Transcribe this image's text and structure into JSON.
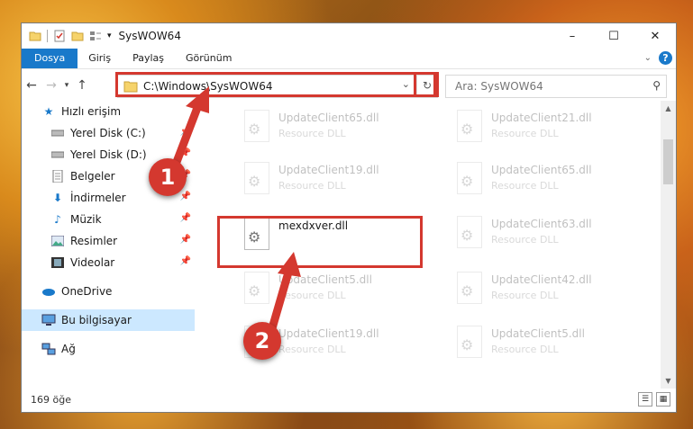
{
  "window": {
    "title": "SysWOW64",
    "controls": {
      "minimize": "–",
      "maximize": "☐",
      "close": "✕"
    }
  },
  "ribbon": {
    "tabs": [
      {
        "label": "Dosya",
        "active": true
      },
      {
        "label": "Giriş",
        "active": false
      },
      {
        "label": "Paylaş",
        "active": false
      },
      {
        "label": "Görünüm",
        "active": false
      }
    ],
    "help_label": "?"
  },
  "address": {
    "path": "C:\\Windows\\SysWOW64",
    "search_placeholder": "Ara: SysWOW64"
  },
  "nav": {
    "items": [
      {
        "label": "Hızlı erişim",
        "icon": "star-icon",
        "pinned": false
      },
      {
        "label": "Yerel Disk (C:)",
        "icon": "drive-icon",
        "pinned": true
      },
      {
        "label": "Yerel Disk (D:)",
        "icon": "drive-icon",
        "pinned": true
      },
      {
        "label": "Belgeler",
        "icon": "document-icon",
        "pinned": true
      },
      {
        "label": "İndirmeler",
        "icon": "download-icon",
        "pinned": true
      },
      {
        "label": "Müzik",
        "icon": "music-icon",
        "pinned": true
      },
      {
        "label": "Resimler",
        "icon": "picture-icon",
        "pinned": true
      },
      {
        "label": "Videolar",
        "icon": "video-icon",
        "pinned": true
      },
      {
        "label": "OneDrive",
        "icon": "cloud-icon",
        "pinned": false
      },
      {
        "label": "Bu bilgisayar",
        "icon": "computer-icon",
        "pinned": false,
        "selected": true
      },
      {
        "label": "Ağ",
        "icon": "network-icon",
        "pinned": false
      }
    ]
  },
  "files": [
    {
      "name": "UpdateClient65.dll",
      "type": "Resource DLL",
      "faded": true
    },
    {
      "name": "UpdateClient21.dll",
      "type": "Resource DLL",
      "faded": true
    },
    {
      "name": "UpdateClient19.dll",
      "type": "Resource DLL",
      "faded": true
    },
    {
      "name": "UpdateClient65.dll",
      "type": "Resource DLL",
      "faded": true
    },
    {
      "name": "mexdxver.dll",
      "type": "",
      "faded": false
    },
    {
      "name": "UpdateClient63.dll",
      "type": "Resource DLL",
      "faded": true
    },
    {
      "name": "UpdateClient5.dll",
      "type": "Resource DLL",
      "faded": true
    },
    {
      "name": "UpdateClient42.dll",
      "type": "Resource DLL",
      "faded": true
    },
    {
      "name": "UpdateClient19.dll",
      "type": "Resource DLL",
      "faded": true
    },
    {
      "name": "UpdateClient5.dll",
      "type": "Resource DLL",
      "faded": true
    }
  ],
  "status": {
    "item_count": "169 öğe"
  },
  "callouts": {
    "one": "1",
    "two": "2"
  },
  "colors": {
    "accent": "#1979ca",
    "highlight": "#d4382f",
    "selected_nav": "#cce8ff"
  }
}
